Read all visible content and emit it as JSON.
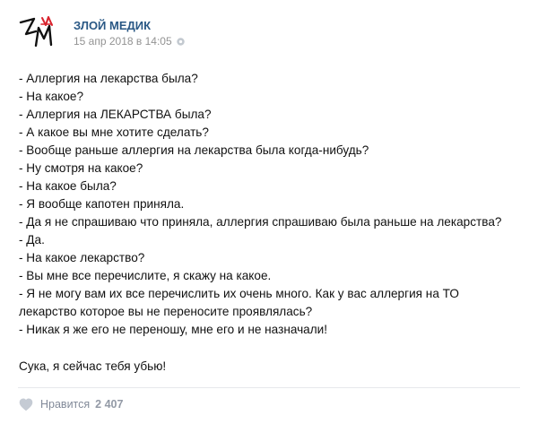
{
  "post": {
    "author": "ЗЛОЙ МЕДИК",
    "date": "15 апр 2018 в 14:05",
    "avatar_icon": "evil-medic-logo",
    "lines": [
      "- Аллергия на лекарства была?",
      "- На какое?",
      "- Аллергия на ЛЕКАРСТВА была?",
      "- А какое вы мне хотите сделать?",
      "- Вообще раньше аллергия на лекарства была когда-нибудь?",
      "- Ну смотря на какое?",
      "- На какое была?",
      "- Я вообще капотен приняла.",
      "- Да я не спрашиваю что приняла, аллергия спрашиваю была раньше на лекарства?",
      "- Да.",
      "- На какое лекарство?",
      "- Вы мне все перечислите, я скажу на какое.",
      "- Я не могу вам их все перечислить их очень много. Как у вас аллергия на ТО",
      "лекарство которое вы не переносите проявлялась?",
      "- Никак я же его не переношу, мне его и не назначали!"
    ],
    "ending": "Сука, я сейчас тебя убью!",
    "like_label": "Нравится",
    "like_count": "2 407",
    "colors": {
      "author": "#2a5885",
      "meta": "#939393",
      "like": "#828a99",
      "accent_red": "#d9232d"
    }
  }
}
